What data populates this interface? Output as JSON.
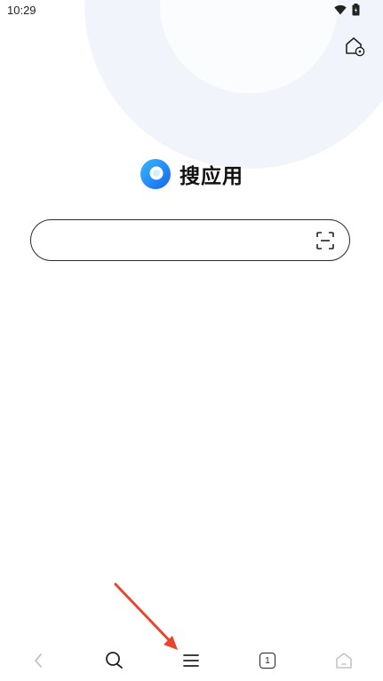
{
  "status_bar": {
    "time": "10:29",
    "icons": [
      "wifi-icon",
      "battery-icon"
    ]
  },
  "header": {
    "settings_icon": "home-gear-icon"
  },
  "brand": {
    "name": "搜应用",
    "logo_icon": "blue-ring-logo",
    "logo_color": "#1e8bff"
  },
  "search": {
    "value": "",
    "placeholder": "",
    "scan_icon": "scan-icon"
  },
  "bottom_nav": {
    "items": [
      {
        "icon": "back-icon",
        "enabled": false
      },
      {
        "icon": "search-icon",
        "enabled": true
      },
      {
        "icon": "menu-icon",
        "enabled": true
      },
      {
        "icon": "tabs-icon",
        "enabled": true,
        "count": "1"
      },
      {
        "icon": "home-icon",
        "enabled": false
      }
    ]
  },
  "colors": {
    "annotation_arrow": "#e8452c",
    "background_ring": "#f1f4fb"
  }
}
